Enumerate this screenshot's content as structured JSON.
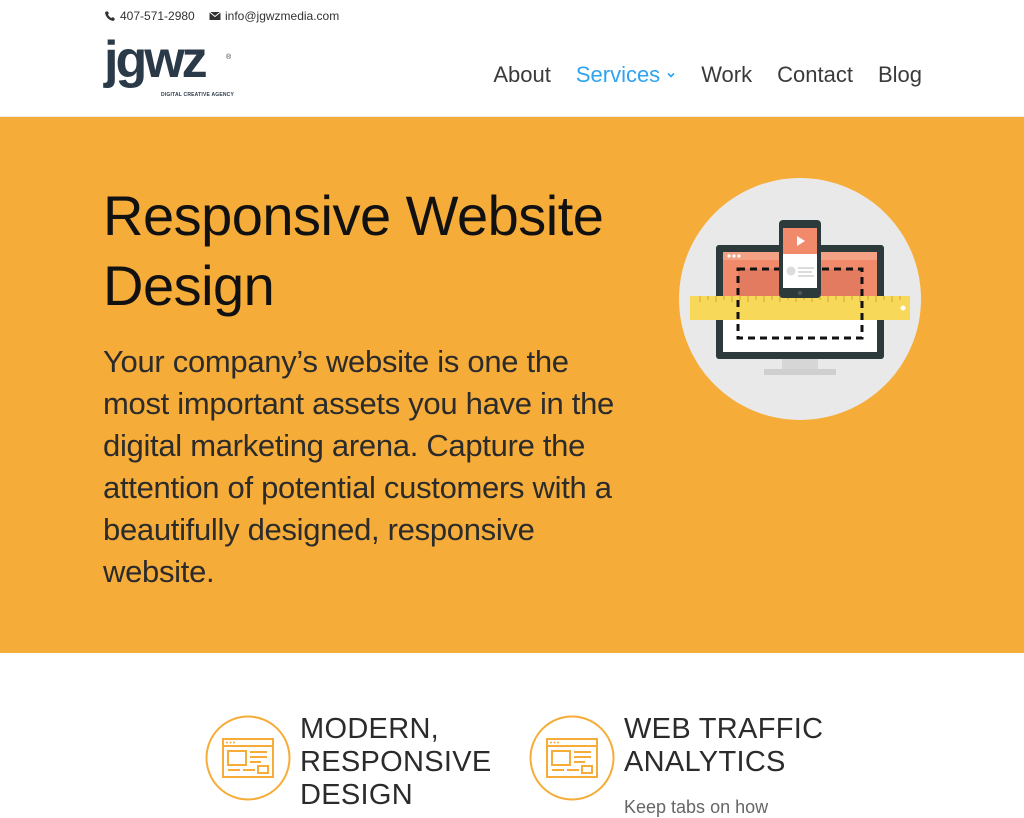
{
  "topbar": {
    "phone": "407-571-2980",
    "email": "info@jgwzmedia.com"
  },
  "logo": {
    "wordmark": "jgwz",
    "registered": "®",
    "tagline": "DIGITAL CREATIVE AGENCY"
  },
  "nav": {
    "items": [
      {
        "label": "About"
      },
      {
        "label": "Services"
      },
      {
        "label": "Work"
      },
      {
        "label": "Contact"
      },
      {
        "label": "Blog"
      }
    ],
    "active": "Services"
  },
  "hero": {
    "title": "Responsive Website Design",
    "text": "Your company’s website is one the most important assets you have in the digital marketing arena. Capture the attention of potential customers with a beautifully designed, responsive website.",
    "background": "#f6ac38"
  },
  "features": [
    {
      "title": "MODERN, RESPONSIVE DESIGN",
      "icon": "browser-window-icon",
      "description": ""
    },
    {
      "title": "WEB TRAFFIC ANALYTICS",
      "icon": "browser-window-icon",
      "description": "Keep tabs on how"
    }
  ],
  "colors": {
    "accent": "#2ea3f2",
    "hero_bg": "#f6ac38",
    "icon_stroke": "#f6ac38",
    "logo": "#2b3a48"
  }
}
